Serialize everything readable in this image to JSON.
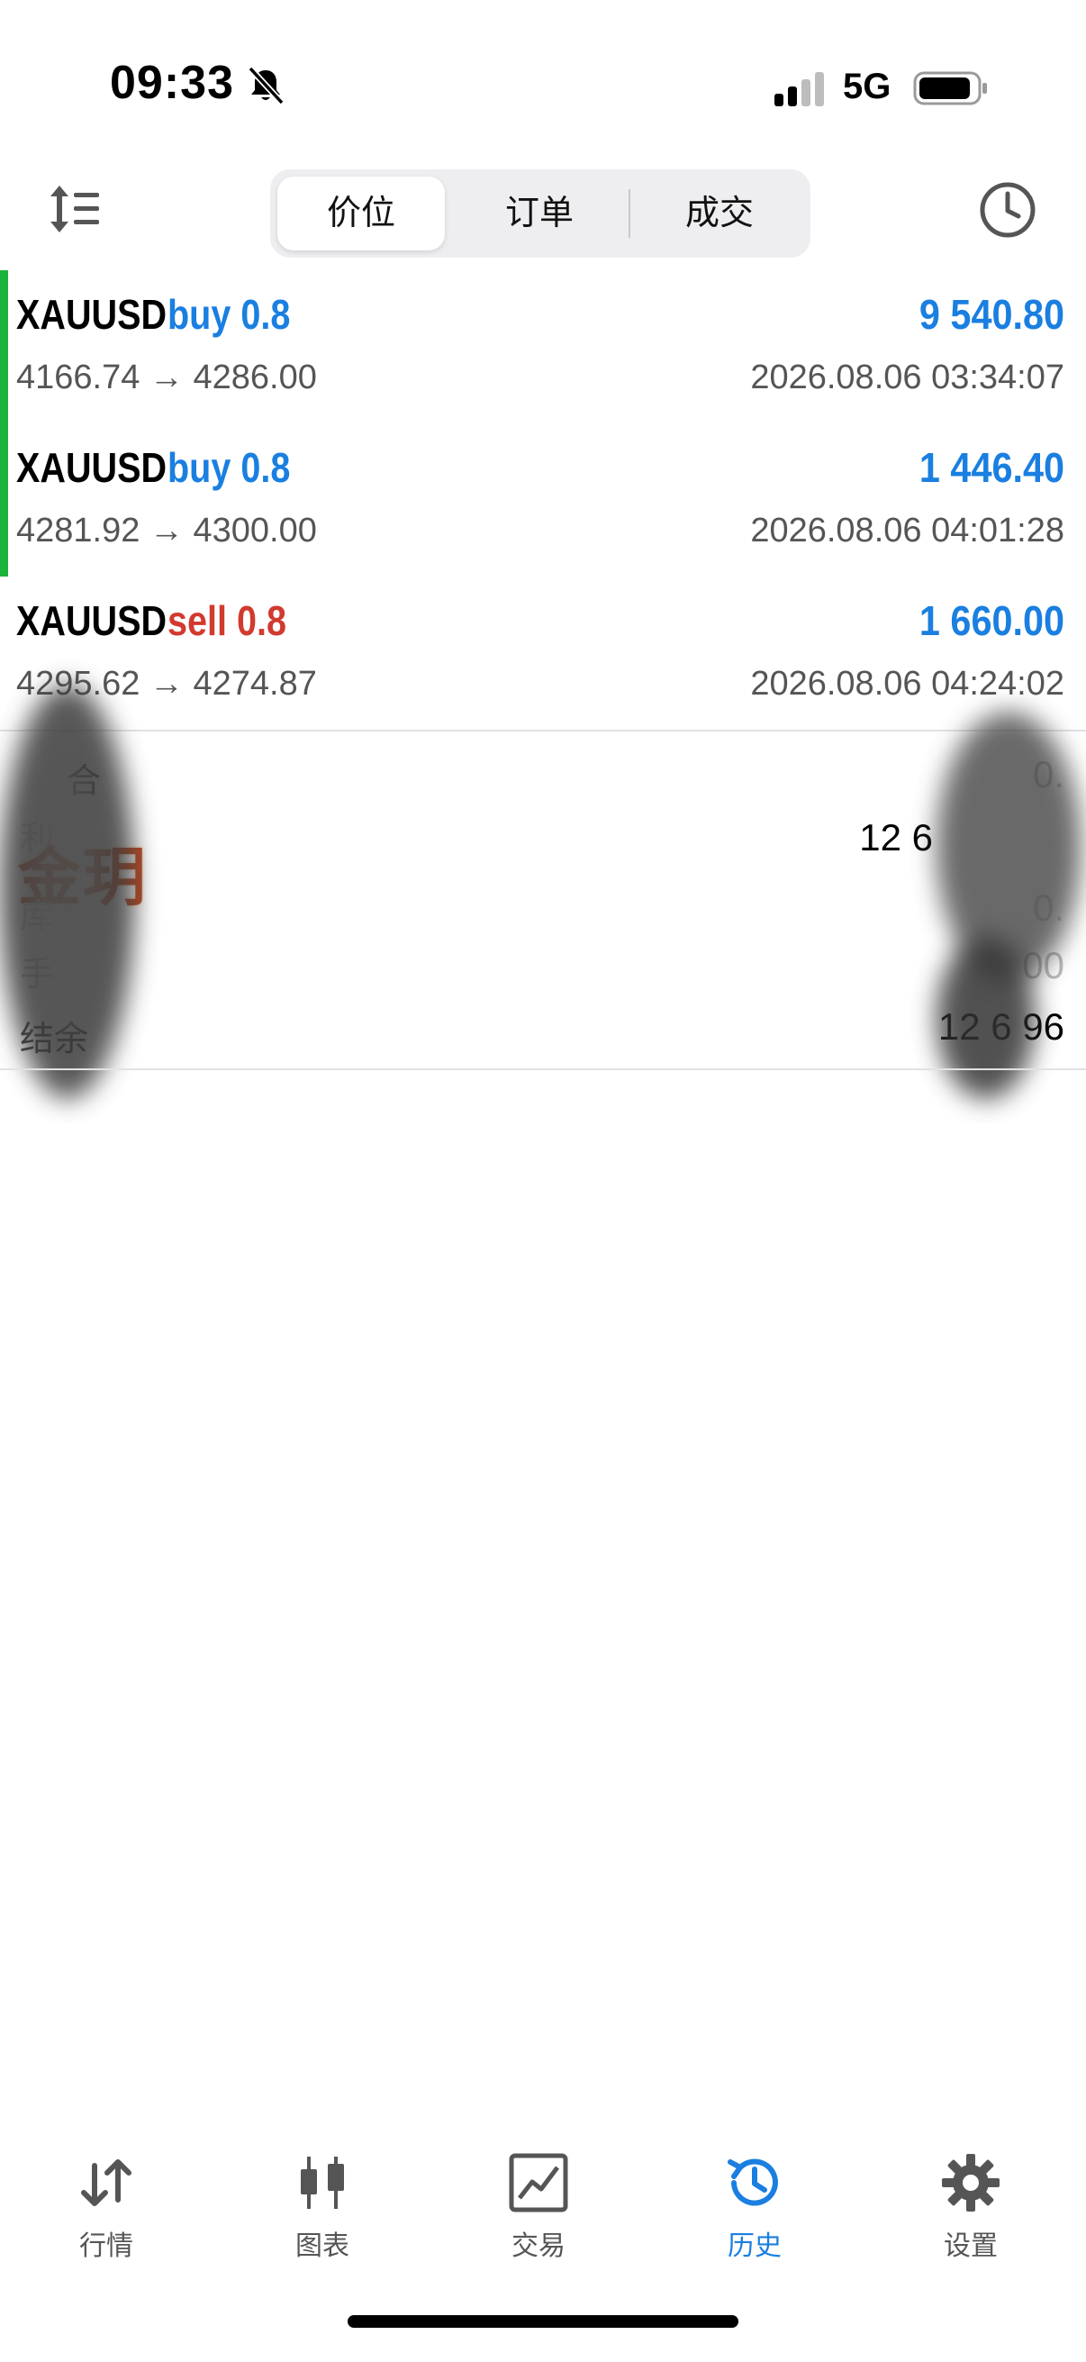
{
  "status_bar": {
    "time": "09:33",
    "network": "5G"
  },
  "segments": [
    {
      "label": "价位",
      "active": true
    },
    {
      "label": "订单",
      "active": false
    },
    {
      "label": "成交",
      "active": false
    }
  ],
  "deals": [
    {
      "symbol": "XAUUSD",
      "side": "buy 0.8",
      "side_color": "#1a7fe0",
      "profit": "9 540.80",
      "prices": "4166.74 → 4286.00",
      "time": "2026.08.06 03:34:07",
      "indicator": true
    },
    {
      "symbol": "XAUUSD",
      "side": "buy 0.8",
      "side_color": "#1a7fe0",
      "profit": "1 446.40",
      "prices": "4281.92 → 4300.00",
      "time": "2026.08.06 04:01:28",
      "indicator": true
    },
    {
      "symbol": "XAUUSD",
      "side": "sell 0.8",
      "side_color": "#d23a2f",
      "profit": "1 660.00",
      "prices": "4295.62 → 4274.87",
      "time": "2026.08.06 04:24:02",
      "indicator": false
    }
  ],
  "summary": {
    "row1_label": "合",
    "row1_value": "0.",
    "row2_label": "利",
    "row2_value": "12 6",
    "row3_label": "库",
    "row3_value": "0.",
    "row4_label": "手",
    "row4_value": "00",
    "balance_label": "结余",
    "balance_value": "12 6  96",
    "watermark": "金玥"
  },
  "tabs": [
    {
      "label": "行情",
      "icon": "arrows-updown-icon",
      "active": false
    },
    {
      "label": "图表",
      "icon": "candlestick-icon",
      "active": false
    },
    {
      "label": "交易",
      "icon": "trade-chart-icon",
      "active": false
    },
    {
      "label": "历史",
      "icon": "history-icon",
      "active": true
    },
    {
      "label": "设置",
      "icon": "gear-icon",
      "active": false
    }
  ],
  "colors": {
    "accent": "#1a7fe0",
    "sell": "#d23a2f",
    "indicator": "#1bb33a"
  }
}
